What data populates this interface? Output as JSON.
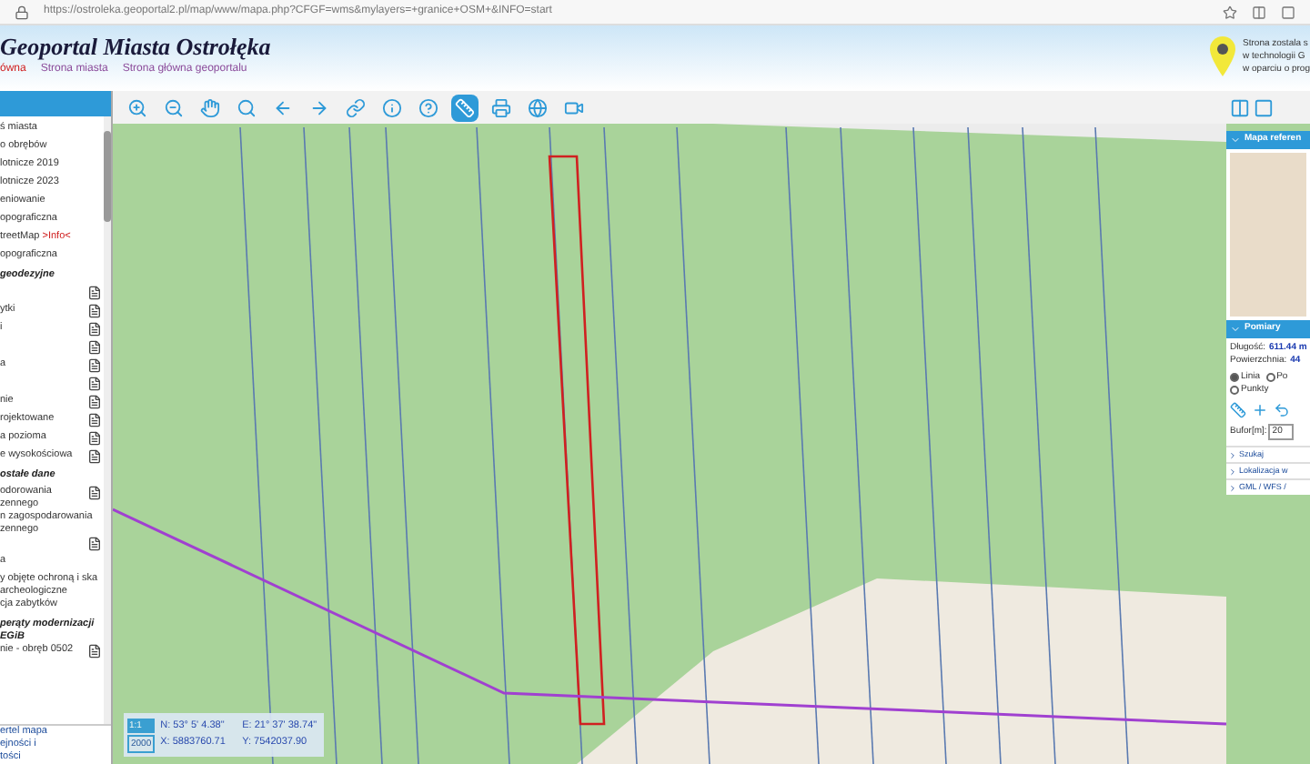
{
  "browser": {
    "url": "https://ostroleka.geoportal2.pl/map/www/mapa.php?CFGF=wms&mylayers=+granice+OSM+&INFO=start"
  },
  "header": {
    "title": "Geoportal Miasta Ostrołęka",
    "links": [
      {
        "label": "ówna",
        "selected": true
      },
      {
        "label": "Strona miasta",
        "selected": false
      },
      {
        "label": "Strona główna geoportalu",
        "selected": false
      }
    ],
    "badge_lines": [
      "Strona zostala s",
      "w technologii G",
      "w oparciu o prog"
    ]
  },
  "tools": [
    {
      "kind": "zoomin",
      "selected": false
    },
    {
      "kind": "zoomout",
      "selected": false
    },
    {
      "kind": "pan",
      "selected": false
    },
    {
      "kind": "search",
      "selected": false
    },
    {
      "kind": "back",
      "selected": false
    },
    {
      "kind": "forward",
      "selected": false
    },
    {
      "kind": "link",
      "selected": false
    },
    {
      "kind": "info",
      "selected": false
    },
    {
      "kind": "query",
      "selected": false
    },
    {
      "kind": "measure",
      "selected": true
    },
    {
      "kind": "print",
      "selected": false
    },
    {
      "kind": "globe",
      "selected": false
    },
    {
      "kind": "video",
      "selected": false
    }
  ],
  "sidebar": {
    "items": [
      {
        "text": "ś miasta",
        "kind": "layer",
        "doc": false
      },
      {
        "text": "o obrębów",
        "kind": "layer",
        "doc": false
      },
      {
        "text": "lotnicze 2019",
        "kind": "layer",
        "doc": false
      },
      {
        "text": "lotnicze 2023",
        "kind": "layer",
        "doc": false
      },
      {
        "text": "eniowanie",
        "kind": "layer",
        "doc": false
      },
      {
        "text": "opograficzna",
        "kind": "layer",
        "doc": false
      },
      {
        "text": "treetMap",
        "kind": "layer",
        "doc": false,
        "link": ">Info<"
      },
      {
        "text": "opograficzna",
        "kind": "layer",
        "doc": false
      },
      {
        "text": "geodezyjne",
        "kind": "group",
        "doc": false
      },
      {
        "kind": "layer",
        "doc": true
      },
      {
        "text": "ytki",
        "kind": "layer",
        "doc": true
      },
      {
        "text": "i",
        "kind": "layer",
        "doc": true
      },
      {
        "kind": "layer",
        "doc": true
      },
      {
        "text": "a",
        "kind": "layer",
        "doc": true
      },
      {
        "kind": "layer",
        "doc": true
      },
      {
        "text": "nie",
        "kind": "layer",
        "doc": true
      },
      {
        "text": "rojektowane",
        "kind": "layer",
        "doc": true
      },
      {
        "text": "a pozioma",
        "kind": "layer",
        "doc": true
      },
      {
        "text": "e wysokościowa",
        "kind": "layer",
        "doc": true
      },
      {
        "text": "ostałe dane",
        "kind": "group",
        "doc": false
      },
      {
        "text": "odorowania zennego",
        "kind": "layer",
        "doc": true
      },
      {
        "text": "n zagospodarowania zennego",
        "kind": "layer",
        "doc": false
      },
      {
        "kind": "layer",
        "doc": true
      },
      {
        "text": "a",
        "kind": "layer",
        "doc": false
      },
      {
        "text": "y objęte ochroną i ska archeologiczne",
        "kind": "layer",
        "doc": false
      },
      {
        "text": "cja zabytków",
        "kind": "layer",
        "doc": false
      },
      {
        "text": "perąty modernizacji EGiB",
        "kind": "group",
        "doc": false
      },
      {
        "text": "nie - obręb 0502",
        "kind": "layer",
        "doc": true
      }
    ],
    "footer": [
      "ertel mapa",
      "ejności i",
      "tości"
    ]
  },
  "coordinates": {
    "scale_top": "1:1",
    "scale": "2000",
    "n": "N: 53° 5' 4.38\"",
    "e": "E: 21° 37' 38.74\"",
    "x": "X: 5883760.71",
    "y": "Y: 7542037.90"
  },
  "right_panel": {
    "reference_title": "Mapa referen",
    "measure_title": "Pomiary",
    "length": {
      "label": "Długość:",
      "value": "611.44 m"
    },
    "area": {
      "label": "Powierzchnia:",
      "value": "44"
    },
    "modes": [
      {
        "label": "Linia",
        "selected": true
      },
      {
        "label": "Po",
        "selected": false
      },
      {
        "label": "Punkty",
        "selected": false
      }
    ],
    "buffer_label": "Bufor[m]:",
    "buffer_value": "20",
    "sections": [
      "Szukaj",
      "Lokalizacja w",
      "GML / WFS / "
    ]
  }
}
